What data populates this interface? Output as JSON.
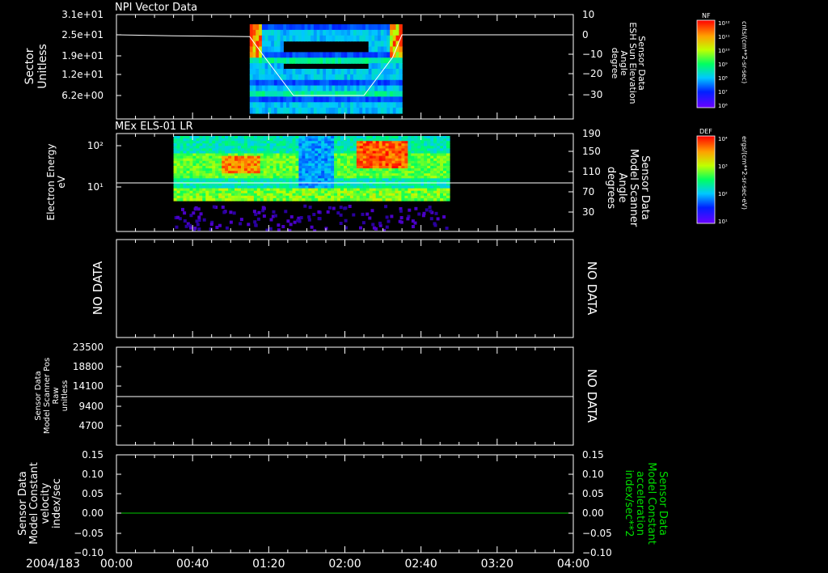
{
  "colors": {
    "background": "#000000",
    "axis": "#ffffff",
    "trace_white": "#ffffff",
    "trace_green": "#00c800",
    "label_green": "#00dd00",
    "nodata": "#ffffff"
  },
  "x_axis": {
    "date_label": "2004/183",
    "ticks": [
      "00:00",
      "00:40",
      "01:20",
      "02:00",
      "02:40",
      "03:20",
      "04:00"
    ]
  },
  "panels": [
    {
      "title": "NPI Vector Data",
      "left_label_lines": [
        "Sector",
        "Unitless"
      ],
      "left_ticks": [
        "3.1e+01",
        "2.5e+01",
        "1.9e+01",
        "1.2e+01",
        "6.2e+00"
      ],
      "right_label_lines": [
        "Sensor Data",
        "ESH Sun Elevation",
        "Angle",
        "degree"
      ],
      "right_ticks": [
        "10",
        "0",
        "−10",
        "−20",
        "−30"
      ],
      "colorbar": {
        "title": "NF",
        "labels": [
          "10¹²",
          "10¹¹",
          "10¹⁰",
          "10⁹",
          "10⁸",
          "10⁷",
          "10⁶"
        ],
        "unit": "cnts/(cm**2-sr-sec)"
      }
    },
    {
      "title": "MEx ELS-01 LR",
      "left_label_lines": [
        "Electron Energy",
        "eV"
      ],
      "left_ticks": [
        "10²",
        "10¹"
      ],
      "right_label_lines": [
        "Sensor Data",
        "Model Scanner",
        "Angle",
        "degrees"
      ],
      "right_ticks": [
        "190",
        "150",
        "110",
        "70",
        "30"
      ],
      "colorbar": {
        "title": "DEF",
        "labels": [
          "10⁴",
          "10³",
          "10²",
          "10¹"
        ],
        "unit": "ergs/(cm**2-sr-sec-eV)"
      }
    },
    {
      "left_text": "NO DATA",
      "right_text": "NO DATA"
    },
    {
      "left_label_lines": [
        "Sensor Data",
        "Model Scanner Pos",
        "Raw",
        "unitless"
      ],
      "left_ticks": [
        "23500",
        "18800",
        "14100",
        "9400",
        "4700"
      ],
      "right_text": "NO DATA"
    },
    {
      "left_label_lines": [
        "Sensor Data",
        "Model Constant",
        "velocity",
        "index/sec"
      ],
      "left_ticks": [
        "0.15",
        "0.10",
        "0.05",
        "0.00",
        "−0.05",
        "−0.10"
      ],
      "right_label_lines": [
        "Sensor Data",
        "Model Constant",
        "acceleration",
        "index/sec**2"
      ],
      "right_ticks": [
        "0.15",
        "0.10",
        "0.05",
        "0.00",
        "−0.05",
        "−0.10"
      ]
    }
  ],
  "chart_data": [
    {
      "type": "heatmap",
      "title": "NPI Vector Data",
      "x_range_minutes": [
        0,
        240
      ],
      "data_span_minutes": [
        70,
        150
      ],
      "y_label": "Sector Unitless",
      "y_ticks": [
        31,
        25,
        19,
        12,
        6.2
      ],
      "series": [
        {
          "name": "Sensor Data ESH Sun Elevation Angle",
          "points": [
            [
              0,
              0
            ],
            [
              30,
              -0.5
            ],
            [
              70,
              -1
            ],
            [
              78,
              -12
            ],
            [
              93,
              -32
            ],
            [
              130,
              -32
            ],
            [
              145,
              -12
            ],
            [
              150,
              0
            ],
            [
              240,
              0
            ]
          ]
        }
      ]
    },
    {
      "type": "heatmap",
      "title": "MEx ELS-01 LR",
      "x_range_minutes": [
        0,
        240
      ],
      "data_span_minutes": [
        30,
        175
      ],
      "y_label": "Electron Energy eV",
      "y_scale": "log",
      "series": [
        {
          "name": "Sensor Data Model Scanner Angle",
          "points": [
            [
              0,
              90
            ],
            [
              240,
              90
            ]
          ]
        }
      ]
    },
    {
      "type": "line",
      "series": []
    },
    {
      "type": "line",
      "series": [
        {
          "name": "Sensor Data Model Scanner Pos Raw",
          "points": [
            [
              0,
              11750
            ],
            [
              240,
              11750
            ]
          ]
        }
      ],
      "ylim": [
        0,
        23500
      ]
    },
    {
      "type": "line",
      "series": [
        {
          "name": "Sensor Data Model Constant velocity",
          "points": [
            [
              0,
              0
            ],
            [
              240,
              0
            ]
          ]
        }
      ],
      "ylim": [
        -0.1,
        0.15
      ]
    }
  ]
}
